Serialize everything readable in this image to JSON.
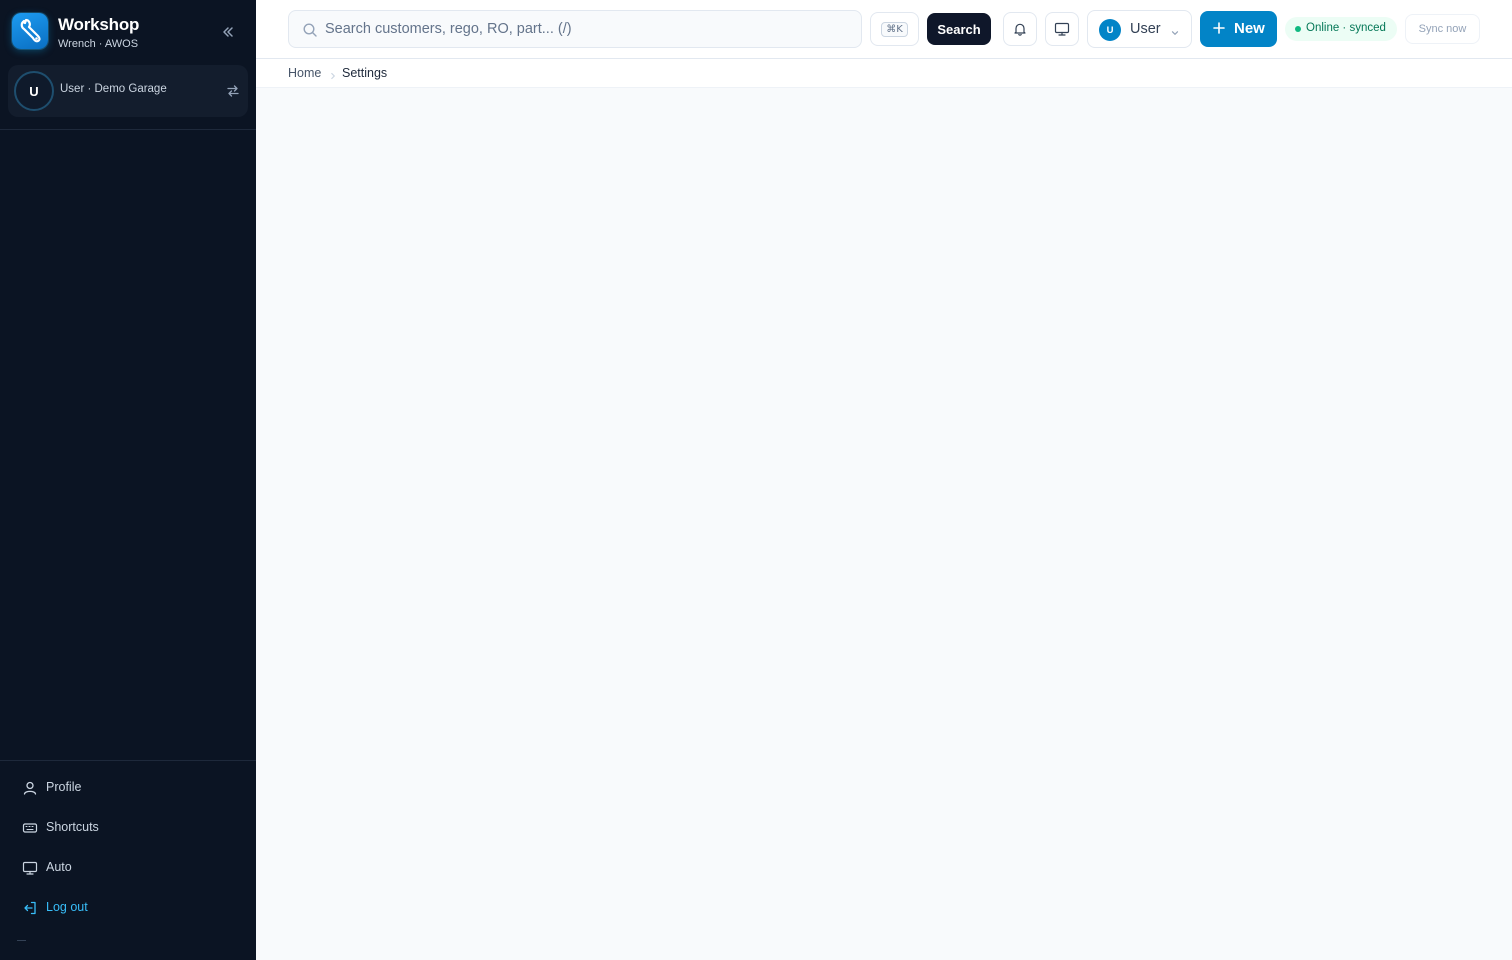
{
  "app": {
    "title": "Workshop",
    "subtitle": "Wrench · AWOS",
    "accent": "#0284c7",
    "sidebar_bg": "#0b1423"
  },
  "sidebar": {
    "user_card": {
      "avatar_initial": "U",
      "label": "User · Demo Garage"
    },
    "footer_items": [
      {
        "label": "Profile",
        "icon": "user-icon"
      },
      {
        "label": "Shortcuts",
        "icon": "keyboard-icon"
      },
      {
        "label": "Auto",
        "icon": "monitor-icon"
      },
      {
        "label": "Log out",
        "icon": "logout-icon"
      }
    ]
  },
  "topbar": {
    "search_placeholder": "Search customers, rego, RO, part... (/)",
    "search_value": "",
    "kbd_hint": "⌘K",
    "search_button": "Search",
    "user_menu": {
      "avatar_initial": "U",
      "label": "User"
    },
    "new_button": "New",
    "status": {
      "label": "Online · synced",
      "color": "#10b981"
    },
    "sync_button": "Sync now"
  },
  "breadcrumb": {
    "home": "Home",
    "current": "Settings"
  }
}
